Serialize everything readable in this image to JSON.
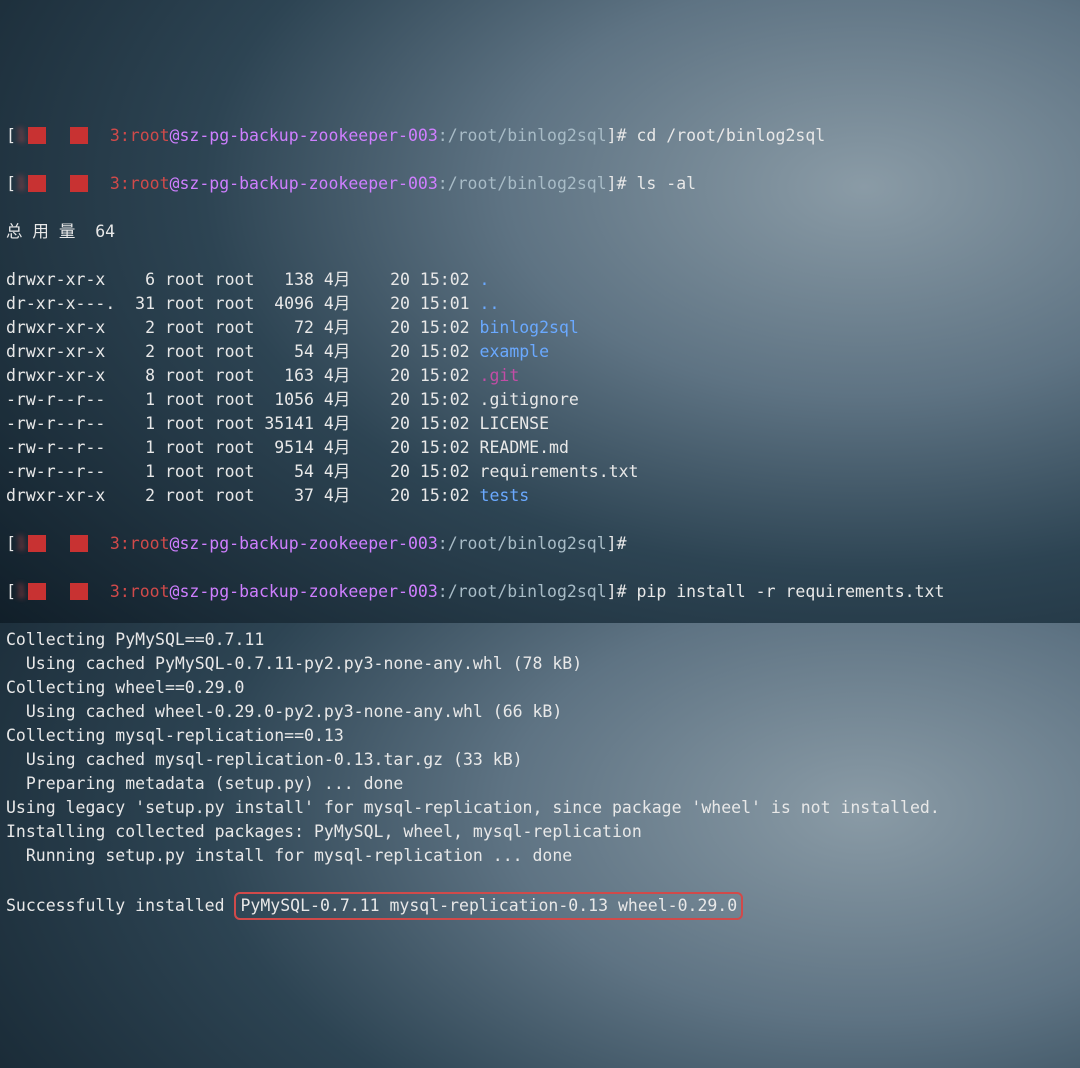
{
  "prompts": [
    {
      "bnum": "3",
      "user": "root",
      "host": "sz-pg-backup-zookeeper-003",
      "cwd": "/root/binlog2sql",
      "cmd": "cd /root/binlog2sql"
    },
    {
      "bnum": "3",
      "user": "root",
      "host": "sz-pg-backup-zookeeper-003",
      "cwd": "/root/binlog2sql",
      "cmd": "ls -al"
    }
  ],
  "ls": {
    "total": "总 用 量  64",
    "rows": [
      {
        "perm": "drwxr-xr-x",
        "links": "6",
        "own": "root",
        "grp": "root",
        "size": "138",
        "mon": "4月",
        "day": "20",
        "time": "15:02",
        "name": ".",
        "cls": "dir"
      },
      {
        "perm": "dr-xr-x---.",
        "links": "31",
        "own": "root",
        "grp": "root",
        "size": "4096",
        "mon": "4月",
        "day": "20",
        "time": "15:01",
        "name": "..",
        "cls": "dir"
      },
      {
        "perm": "drwxr-xr-x",
        "links": "2",
        "own": "root",
        "grp": "root",
        "size": "72",
        "mon": "4月",
        "day": "20",
        "time": "15:02",
        "name": "binlog2sql",
        "cls": "dir"
      },
      {
        "perm": "drwxr-xr-x",
        "links": "2",
        "own": "root",
        "grp": "root",
        "size": "54",
        "mon": "4月",
        "day": "20",
        "time": "15:02",
        "name": "example",
        "cls": "dir"
      },
      {
        "perm": "drwxr-xr-x",
        "links": "8",
        "own": "root",
        "grp": "root",
        "size": "163",
        "mon": "4月",
        "day": "20",
        "time": "15:02",
        "name": ".git",
        "cls": "git"
      },
      {
        "perm": "-rw-r--r--",
        "links": "1",
        "own": "root",
        "grp": "root",
        "size": "1056",
        "mon": "4月",
        "day": "20",
        "time": "15:02",
        "name": ".gitignore",
        "cls": ""
      },
      {
        "perm": "-rw-r--r--",
        "links": "1",
        "own": "root",
        "grp": "root",
        "size": "35141",
        "mon": "4月",
        "day": "20",
        "time": "15:02",
        "name": "LICENSE",
        "cls": ""
      },
      {
        "perm": "-rw-r--r--",
        "links": "1",
        "own": "root",
        "grp": "root",
        "size": "9514",
        "mon": "4月",
        "day": "20",
        "time": "15:02",
        "name": "README.md",
        "cls": ""
      },
      {
        "perm": "-rw-r--r--",
        "links": "1",
        "own": "root",
        "grp": "root",
        "size": "54",
        "mon": "4月",
        "day": "20",
        "time": "15:02",
        "name": "requirements.txt",
        "cls": ""
      },
      {
        "perm": "drwxr-xr-x",
        "links": "2",
        "own": "root",
        "grp": "root",
        "size": "37",
        "mon": "4月",
        "day": "20",
        "time": "15:02",
        "name": "tests",
        "cls": "dir"
      }
    ]
  },
  "prompts2": [
    {
      "bnum": "3",
      "user": "root",
      "host": "sz-pg-backup-zookeeper-003",
      "cwd": "/root/binlog2sql",
      "cmd": ""
    },
    {
      "bnum": "3",
      "user": "root",
      "host": "sz-pg-backup-zookeeper-003",
      "cwd": "/root/binlog2sql",
      "cmd": "pip install -r requirements.txt"
    }
  ],
  "pip": [
    "Collecting PyMySQL==0.7.11",
    "  Using cached PyMySQL-0.7.11-py2.py3-none-any.whl (78 kB)",
    "Collecting wheel==0.29.0",
    "  Using cached wheel-0.29.0-py2.py3-none-any.whl (66 kB)",
    "Collecting mysql-replication==0.13",
    "  Using cached mysql-replication-0.13.tar.gz (33 kB)",
    "  Preparing metadata (setup.py) ... done",
    "Using legacy 'setup.py install' for mysql-replication, since package 'wheel' is not installed.",
    "Installing collected packages: PyMySQL, wheel, mysql-replication",
    "  Running setup.py install for mysql-replication ... done"
  ],
  "success": {
    "pre": "Successfully installed ",
    "pkgs": "PyMySQL-0.7.11 mysql-replication-0.13 wheel-0.29.0"
  },
  "colors": {
    "accent_red": "#d14a4a",
    "dir_blue": "#6aa9ff",
    "host_purple": "#cf7fff",
    "git_magenta": "#c24da6"
  }
}
